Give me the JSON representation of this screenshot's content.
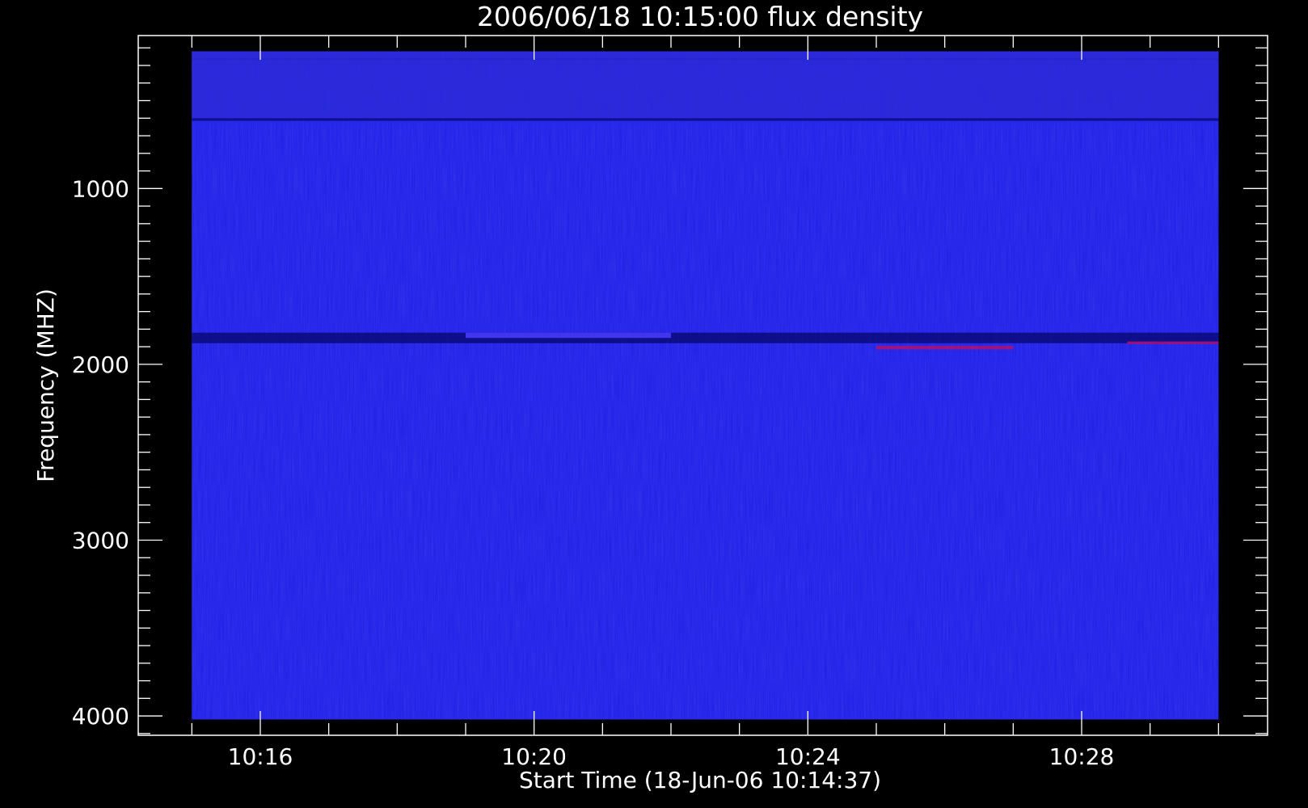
{
  "chart_data": {
    "type": "heatmap",
    "title": "2006/06/18 10:15:00 flux density",
    "xlabel": "Start Time (18-Jun-06 10:14:37)",
    "ylabel": "Frequency (MHZ)",
    "x_start": "10:14:37",
    "x_range": [
      "10:14:13",
      "10:30:43"
    ],
    "x_data_range": [
      "10:15:00",
      "10:30:00"
    ],
    "x_ticks": [
      "10:16",
      "10:20",
      "10:24",
      "10:28"
    ],
    "x_minor_tick_minutes": 1,
    "y_range": [
      130,
      4110
    ],
    "y_data_range": [
      220,
      4020
    ],
    "y_reversed": true,
    "y_ticks": [
      1000,
      2000,
      3000,
      4000
    ],
    "y_minor_step": 100,
    "grid": false,
    "colors": {
      "background": "#000000",
      "axes": "#ffffff",
      "spectrum_base": "#1e1ee6"
    },
    "features": [
      {
        "label": "dark band",
        "freq_start": 1820,
        "freq_end": 1880,
        "time_start": "10:15:00",
        "time_end": "10:30:00",
        "color": "#0a0a7a"
      },
      {
        "label": "bright band",
        "freq_start": 1820,
        "freq_end": 1850,
        "time_start": "10:19:00",
        "time_end": "10:22:00",
        "color": "#4a3cff"
      },
      {
        "label": "red segment",
        "freq_start": 1895,
        "freq_end": 1915,
        "time_start": "10:25:00",
        "time_end": "10:27:00",
        "color": "#b01070"
      },
      {
        "label": "red segment",
        "freq_start": 1870,
        "freq_end": 1885,
        "time_start": "10:28:40",
        "time_end": "10:30:00",
        "color": "#b01070"
      },
      {
        "label": "dark line",
        "freq_start": 600,
        "freq_end": 615,
        "time_start": "10:15:00",
        "time_end": "10:30:00",
        "color": "#0a0a80"
      },
      {
        "label": "dark line",
        "freq_start": 260,
        "freq_end": 270,
        "time_start": "10:15:00",
        "time_end": "10:30:00",
        "color": "#0a0a80"
      },
      {
        "label": "noisy band",
        "freq_start": 220,
        "freq_end": 600,
        "time_start": "10:15:00",
        "time_end": "10:30:00",
        "color": "#2a2ad8"
      }
    ]
  }
}
